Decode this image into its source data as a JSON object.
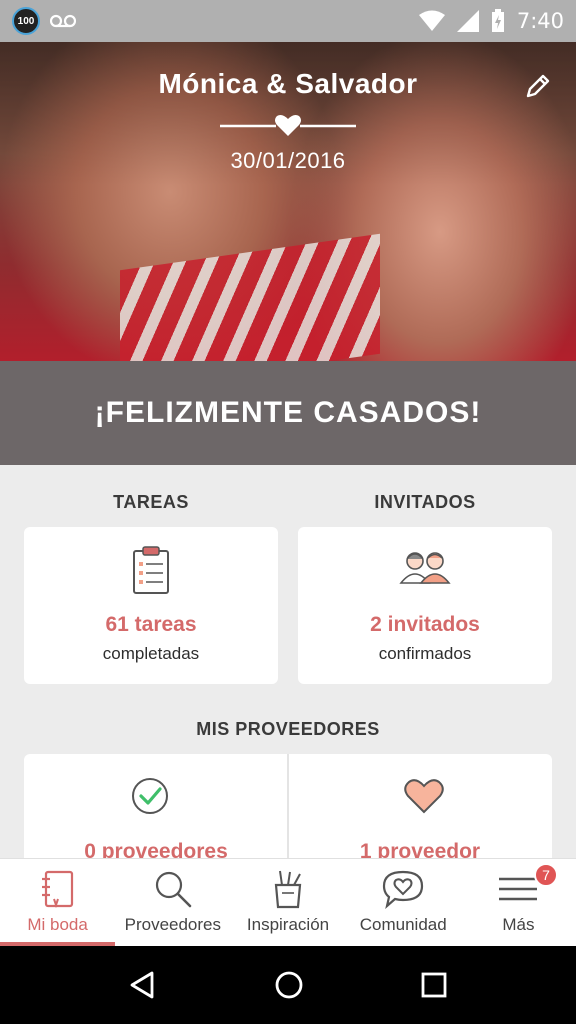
{
  "status_bar": {
    "time": "7:40",
    "left_badge": "100",
    "icons": [
      "voicemail-icon",
      "wifi-icon",
      "signal-icon",
      "battery-charging-icon"
    ]
  },
  "hero": {
    "couple_name": "Mónica & Salvador",
    "date": "30/01/2016"
  },
  "banner": {
    "text": "¡FELIZMENTE CASADOS!"
  },
  "tasks": {
    "title": "TAREAS",
    "count": "61 tareas",
    "sub": "completadas",
    "icon": "clipboard-checklist-icon"
  },
  "guests": {
    "title": "INVITADOS",
    "count": "2 invitados",
    "sub": "confirmados",
    "icon": "couple-icon"
  },
  "vendors": {
    "title": "MIS PROVEEDORES",
    "left_count": "0 proveedores",
    "right_count": "1 proveedor",
    "left_icon": "check-circle-icon",
    "right_icon": "heart-icon"
  },
  "bottom_nav": {
    "items": [
      {
        "label": "Mi boda",
        "icon": "notebook-icon"
      },
      {
        "label": "Proveedores",
        "icon": "search-icon"
      },
      {
        "label": "Inspiración",
        "icon": "paint-cup-icon"
      },
      {
        "label": "Comunidad",
        "icon": "chat-heart-icon"
      },
      {
        "label": "Más",
        "icon": "menu-icon"
      }
    ],
    "badge": "7"
  },
  "colors": {
    "accent": "#d46a6a",
    "banner": "#6d6768",
    "background": "#ececec"
  }
}
